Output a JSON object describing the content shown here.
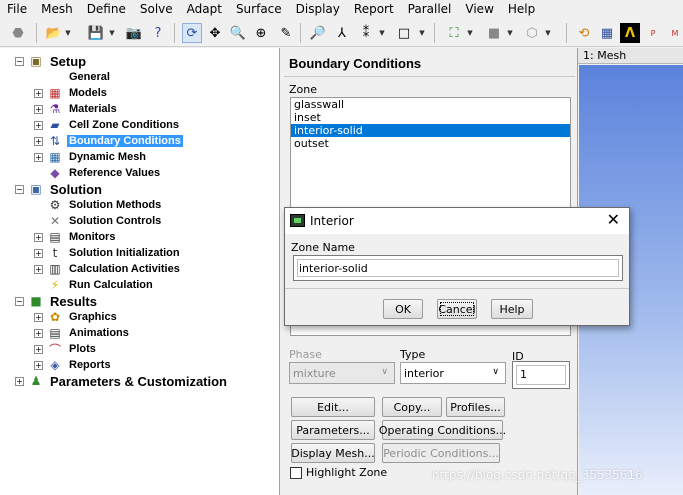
{
  "menu": [
    "File",
    "Mesh",
    "Define",
    "Solve",
    "Adapt",
    "Surface",
    "Display",
    "Report",
    "Parallel",
    "View",
    "Help"
  ],
  "tree": {
    "items": [
      {
        "label": "Setup",
        "level": 0,
        "icon": "setup-icon",
        "glyph": "▣",
        "color": "#7a6a2a"
      },
      {
        "label": "General",
        "level": 1,
        "icon": "general-icon",
        "glyph": "",
        "color": "#000"
      },
      {
        "label": "Models",
        "level": 1,
        "icon": "models-icon",
        "glyph": "▦",
        "color": "#c03030"
      },
      {
        "label": "Materials",
        "level": 1,
        "icon": "materials-icon",
        "glyph": "⚗",
        "color": "#6a2a9a"
      },
      {
        "label": "Cell Zone Conditions",
        "level": 1,
        "icon": "cell-zone-icon",
        "glyph": "▰",
        "color": "#2b4f9e"
      },
      {
        "label": "Boundary Conditions",
        "level": 1,
        "icon": "boundary-conditions-icon",
        "glyph": "⇅",
        "color": "#2b4f9e"
      },
      {
        "label": "Dynamic Mesh",
        "level": 1,
        "icon": "dynamic-mesh-icon",
        "glyph": "▦",
        "color": "#2a6aa8"
      },
      {
        "label": "Reference Values",
        "level": 1,
        "icon": "reference-values-icon",
        "glyph": "◆",
        "color": "#7a4aa8"
      },
      {
        "label": "Solution",
        "level": 0,
        "icon": "solution-icon",
        "glyph": "▣",
        "color": "#3a6aa0"
      },
      {
        "label": "Solution Methods",
        "level": 1,
        "icon": "solution-methods-icon",
        "glyph": "⚙",
        "color": "#333"
      },
      {
        "label": "Solution Controls",
        "level": 1,
        "icon": "solution-controls-icon",
        "glyph": "✕",
        "color": "#777"
      },
      {
        "label": "Monitors",
        "level": 1,
        "icon": "monitors-icon",
        "glyph": "▤",
        "color": "#333"
      },
      {
        "label": "Solution Initialization",
        "level": 1,
        "icon": "solution-initialization-icon",
        "glyph": "t",
        "color": "#333"
      },
      {
        "label": "Calculation Activities",
        "level": 1,
        "icon": "calculation-activities-icon",
        "glyph": "▥",
        "color": "#333"
      },
      {
        "label": "Run Calculation",
        "level": 1,
        "icon": "run-calculation-icon",
        "glyph": "⚡",
        "color": "#d8b000"
      },
      {
        "label": "Results",
        "level": 0,
        "icon": "results-icon",
        "glyph": "■",
        "color": "#2e8b2e"
      },
      {
        "label": "Graphics",
        "level": 1,
        "icon": "graphics-icon",
        "glyph": "✿",
        "color": "#c88a00"
      },
      {
        "label": "Animations",
        "level": 1,
        "icon": "animations-icon",
        "glyph": "▤",
        "color": "#333"
      },
      {
        "label": "Plots",
        "level": 1,
        "icon": "plots-icon",
        "glyph": "⌒",
        "color": "#c03030"
      },
      {
        "label": "Reports",
        "level": 1,
        "icon": "reports-icon",
        "glyph": "◈",
        "color": "#3a5aa8"
      },
      {
        "label": "Parameters & Customization",
        "level": 0,
        "icon": "parameters-icon",
        "glyph": "♟",
        "color": "#2e8b2e"
      }
    ],
    "selected": "Boundary Conditions"
  },
  "panel": {
    "title": "Boundary Conditions",
    "zone_label": "Zone",
    "zones": [
      "glasswall",
      "inset",
      "interior-solid",
      "outset"
    ],
    "selected_zone": "interior-solid",
    "phase_label": "Phase",
    "phase_value": "mixture",
    "type_label": "Type",
    "type_value": "interior",
    "id_label": "ID",
    "id_value": "1",
    "buttons": {
      "edit": "Edit...",
      "copy": "Copy...",
      "profiles": "Profiles...",
      "parameters": "Parameters...",
      "operating_conditions": "Operating Conditions...",
      "display_mesh": "Display Mesh...",
      "periodic_conditions": "Periodic Conditions..."
    },
    "highlight_zone_label": "Highlight Zone"
  },
  "graphics": {
    "tab_label": "1: Mesh"
  },
  "dialog": {
    "title": "Interior",
    "close_glyph": "✕",
    "zone_name_label": "Zone Name",
    "zone_name_value": "interior-solid",
    "ok": "OK",
    "cancel": "Cancel",
    "help": "Help"
  },
  "watermark": "https://blog.csdn.net/qq_35535616"
}
